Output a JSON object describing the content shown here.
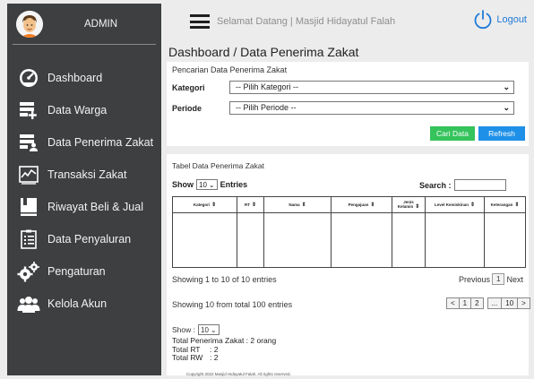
{
  "sidebar": {
    "admin_label": "ADMIN",
    "items": [
      {
        "label": "Dashboard",
        "icon": "speedometer-icon"
      },
      {
        "label": "Data Warga",
        "icon": "list-add-icon"
      },
      {
        "label": "Data Penerima Zakat",
        "icon": "list-user-icon"
      },
      {
        "label": "Transaksi Zakat",
        "icon": "line-chart-icon"
      },
      {
        "label": "Riwayat Beli & Jual",
        "icon": "book-icon"
      },
      {
        "label": "Data Penyaluran",
        "icon": "clipboard-icon"
      },
      {
        "label": "Pengaturan",
        "icon": "gears-icon"
      },
      {
        "label": "Kelola Akun",
        "icon": "users-icon"
      }
    ]
  },
  "topbar": {
    "welcome": "Selamat Datang | Masjid Hidayatul Falah",
    "logout": "Logout"
  },
  "page_title": "Dashboard / Data Penerima Zakat",
  "search": {
    "caption": "Pencarian Data Penerima Zakat",
    "kategori_label": "Kategori",
    "kategori_value": "-- Pilih Kategori --",
    "periode_label": "Periode",
    "periode_value": "-- Pilih Periode --",
    "cari_button": "Cari Data",
    "refresh_button": "Refresh"
  },
  "table": {
    "caption": "Tabel Data Penerima Zakat",
    "show_label": "Show",
    "show_value": "10",
    "entries_label": "Entries",
    "search_label": "Search :",
    "columns": [
      "Kategori",
      "RT",
      "Nama",
      "Pengajuan",
      "Jenis Kelamin",
      "Level Kemiskinan",
      "Keterangan"
    ],
    "info_entries": "Showing 1 to 10 of 10 entries",
    "pager_previous": "Previous",
    "pager_current": "1",
    "pager_next": "Next",
    "info_total": "Showing 10 from total 100 entries",
    "pages": [
      "<",
      "1",
      "2",
      "...",
      "10",
      ">"
    ],
    "show2_label": "Show :",
    "show2_value": "10",
    "totals": {
      "penerima": "Total Penerima Zakat : 2 orang",
      "rt_label": "Total RT",
      "rt_value": ": 2",
      "rw_label": "Total RW",
      "rw_value": ": 2"
    },
    "copyright": "Copyright  2022 Masjid Hidayatul Falah. All rights reserved."
  },
  "colors": {
    "sidebar_bg": "#3d3f41",
    "accent_blue": "#1e90e8",
    "accent_green": "#35c35c"
  }
}
